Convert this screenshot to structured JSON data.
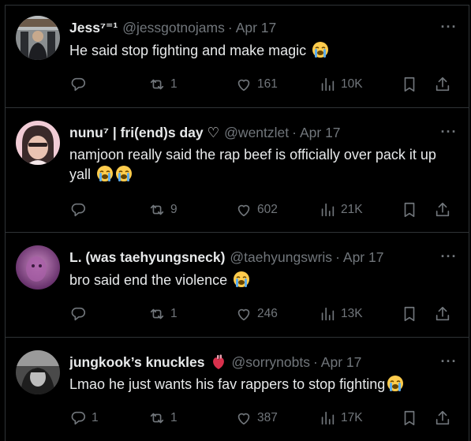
{
  "tweets": [
    {
      "name": "Jess⁷⁼¹",
      "handle": "@jessgotnojams",
      "dot": "·",
      "date": "Apr 17",
      "text": "He said stop fighting and make magic",
      "emojis": 1,
      "replies": "",
      "retweets": "1",
      "likes": "161",
      "views": "10K"
    },
    {
      "name": "nunu⁷ | fri(end)s day ♡",
      "handle": "@wentzlet",
      "dot": "·",
      "date": "Apr 17",
      "text": "namjoon really said the rap beef is officially over pack it up yall",
      "emojis": 2,
      "replies": "",
      "retweets": "9",
      "likes": "602",
      "views": "21K"
    },
    {
      "name": "L. (was taehyungsneck)",
      "handle": "@taehyungswris",
      "dot": "·",
      "date": "Apr 17",
      "text": "bro said end the violence",
      "emojis": 1,
      "replies": "",
      "retweets": "1",
      "likes": "246",
      "views": "13K"
    },
    {
      "name": "jungkook’s knuckles",
      "handle": "@sorrynobts",
      "dot": "·",
      "date": "Apr 17",
      "text": "Lmao he just wants his fav rappers to stop fighting",
      "emojis": 1,
      "replies": "1",
      "retweets": "1",
      "likes": "387",
      "views": "17K"
    }
  ],
  "more_label": "···",
  "icons": {
    "reply": "reply-icon",
    "retweet": "retweet-icon",
    "like": "heart-icon",
    "views": "views-icon",
    "bookmark": "bookmark-icon",
    "share": "share-icon",
    "emoji": "loudly-crying-face-emoji",
    "anatomical-heart": "anatomical-heart-emoji"
  },
  "colors": {
    "background": "#000000",
    "text": "#e7e9ea",
    "secondary": "#71767b",
    "divider": "#2f3336"
  }
}
